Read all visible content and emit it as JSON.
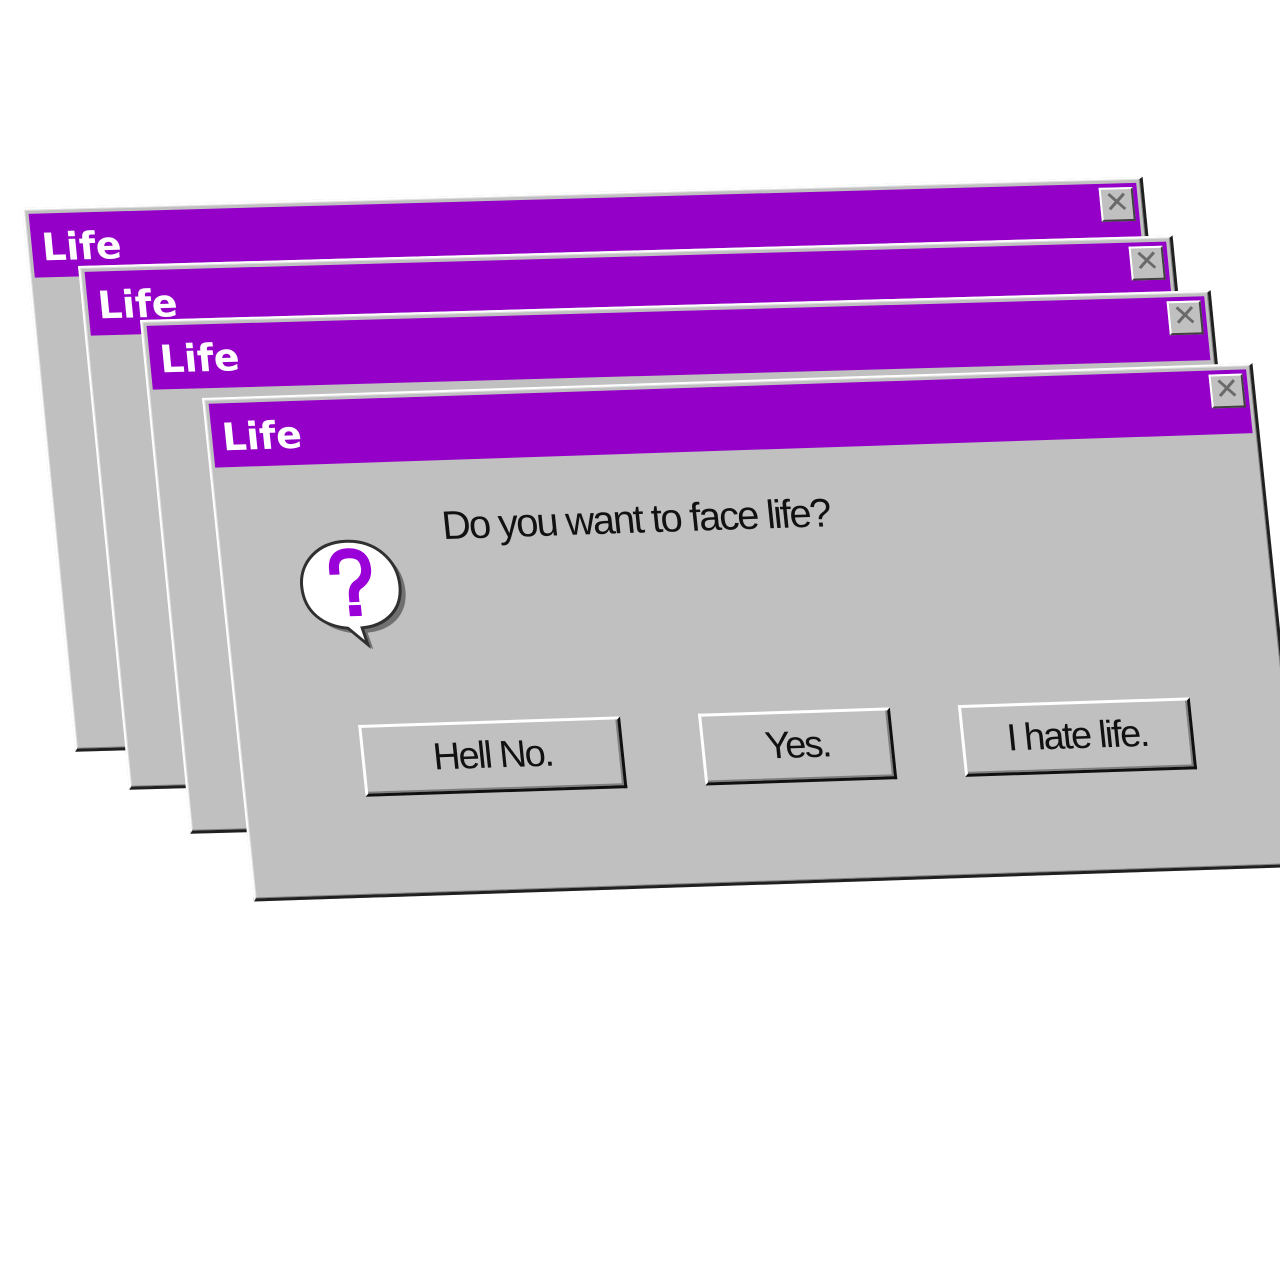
{
  "dialogs": [
    {
      "title": "Life"
    },
    {
      "title": "Life"
    },
    {
      "title": "Life"
    },
    {
      "title": "Life"
    }
  ],
  "front": {
    "message": "Do you want to face life?",
    "buttons": {
      "hell_no": "Hell No.",
      "yes": "Yes.",
      "hate": "I hate life."
    }
  },
  "close_glyph": "✕",
  "icon": "question-bubble-icon",
  "colors": {
    "titlebar": "#9400c8",
    "dialog_bg": "#c0c0c0",
    "question_mark": "#9a00d8"
  }
}
